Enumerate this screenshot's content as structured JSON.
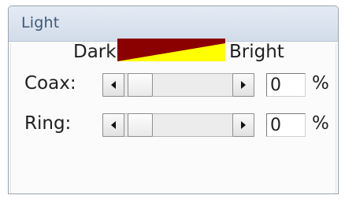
{
  "panel": {
    "title": "Light"
  },
  "brightness": {
    "dark_label": "Dark",
    "bright_label": "Bright",
    "gradient_dark_color": "#8b0000",
    "gradient_bright_color": "#ffff00"
  },
  "controls": [
    {
      "label": "Coax:",
      "value": "0",
      "unit": "%",
      "slider_fraction": 0,
      "left_icon": "arrow-left-icon",
      "right_icon": "arrow-right-icon"
    },
    {
      "label": "Ring:",
      "value": "0",
      "unit": "%",
      "slider_fraction": 0,
      "left_icon": "arrow-left-icon",
      "right_icon": "arrow-right-icon"
    }
  ]
}
